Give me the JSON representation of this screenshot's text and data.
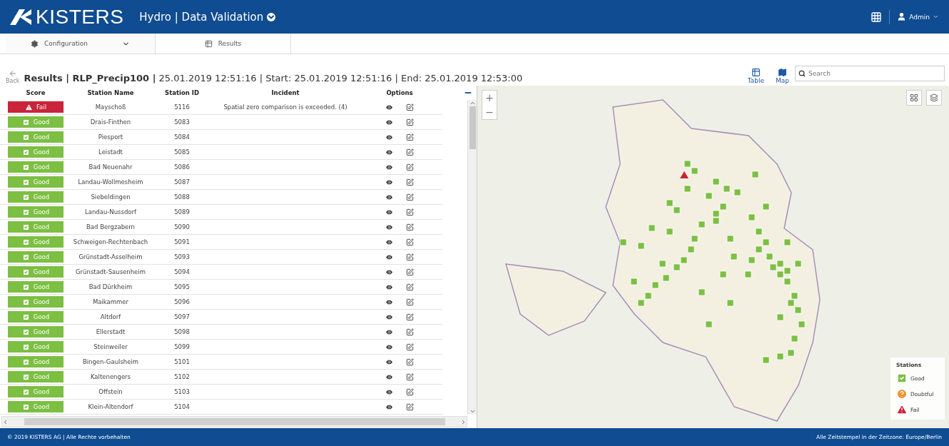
{
  "header": {
    "logo": "KISTERS",
    "app_title": "Hydro | Data Validation",
    "user": "Admin"
  },
  "nav_tabs": [
    {
      "label": "Configuration",
      "selected": false,
      "kind": "dropdown"
    },
    {
      "label": "Results",
      "selected": true,
      "kind": "plain"
    }
  ],
  "back": "Back",
  "title": {
    "name": "Results | RLP_Precip100 |",
    "details": "25.01.2019 12:51:16 | Start: 25.01.2019 12:51:16 | End: 25.01.2019 12:53:00"
  },
  "view_buttons": [
    {
      "label": "Table",
      "kind": "table"
    },
    {
      "label": "Map",
      "kind": "map"
    }
  ],
  "search": {
    "placeholder": "Search"
  },
  "table": {
    "columns": [
      "Score",
      "Station Name",
      "Station ID",
      "Incident",
      "Options"
    ],
    "rows": [
      {
        "score": "Fail",
        "kind": "fail",
        "name": "Mayschoß",
        "id": "5116",
        "incident": "Spatial zero comparison is exceeded. (4)"
      },
      {
        "score": "Good",
        "kind": "good",
        "name": "Drais-Finthen",
        "id": "5083"
      },
      {
        "score": "Good",
        "kind": "good",
        "name": "Piesport",
        "id": "5084"
      },
      {
        "score": "Good",
        "kind": "good",
        "name": "Leistadt",
        "id": "5085"
      },
      {
        "score": "Good",
        "kind": "good",
        "name": "Bad Neuenahr",
        "id": "5086"
      },
      {
        "score": "Good",
        "kind": "good",
        "name": "Landau-Wollmesheim",
        "id": "5087"
      },
      {
        "score": "Good",
        "kind": "good",
        "name": "Siebeldingen",
        "id": "5088"
      },
      {
        "score": "Good",
        "kind": "good",
        "name": "Landau-Nussdorf",
        "id": "5089"
      },
      {
        "score": "Good",
        "kind": "good",
        "name": "Bad Bergzabern",
        "id": "5090"
      },
      {
        "score": "Good",
        "kind": "good",
        "name": "Schweigen-Rechtenbach",
        "id": "5091"
      },
      {
        "score": "Good",
        "kind": "good",
        "name": "Grünstadt-Asselheim",
        "id": "5093"
      },
      {
        "score": "Good",
        "kind": "good",
        "name": "Grünstadt-Sausenheim",
        "id": "5094"
      },
      {
        "score": "Good",
        "kind": "good",
        "name": "Bad Dürkheim",
        "id": "5095"
      },
      {
        "score": "Good",
        "kind": "good",
        "name": "Maikammer",
        "id": "5096"
      },
      {
        "score": "Good",
        "kind": "good",
        "name": "Altdorf",
        "id": "5097"
      },
      {
        "score": "Good",
        "kind": "good",
        "name": "Ellerstadt",
        "id": "5098"
      },
      {
        "score": "Good",
        "kind": "good",
        "name": "Steinweiler",
        "id": "5099"
      },
      {
        "score": "Good",
        "kind": "good",
        "name": "Bingen-Gaulsheim",
        "id": "5101"
      },
      {
        "score": "Good",
        "kind": "good",
        "name": "Kaltenengers",
        "id": "5102"
      },
      {
        "score": "Good",
        "kind": "good",
        "name": "Offstein",
        "id": "5103"
      },
      {
        "score": "Good",
        "kind": "good",
        "name": "Klein-Altendorf",
        "id": "5104"
      }
    ]
  },
  "map": {
    "zoom_in": "+",
    "zoom_out": "−",
    "legend": {
      "title": "Stations",
      "items": [
        {
          "label": "Good",
          "kind": "good"
        },
        {
          "label": "Doubtful",
          "kind": "doubtful"
        },
        {
          "label": "Fail",
          "kind": "fail"
        }
      ]
    }
  },
  "footer": {
    "copyright": "© 2019 KISTERS AG | Alle Rechte vorbehalten",
    "timezone": "Alle Zeitstempel in der Zeitzone: Europe/Berlin"
  }
}
